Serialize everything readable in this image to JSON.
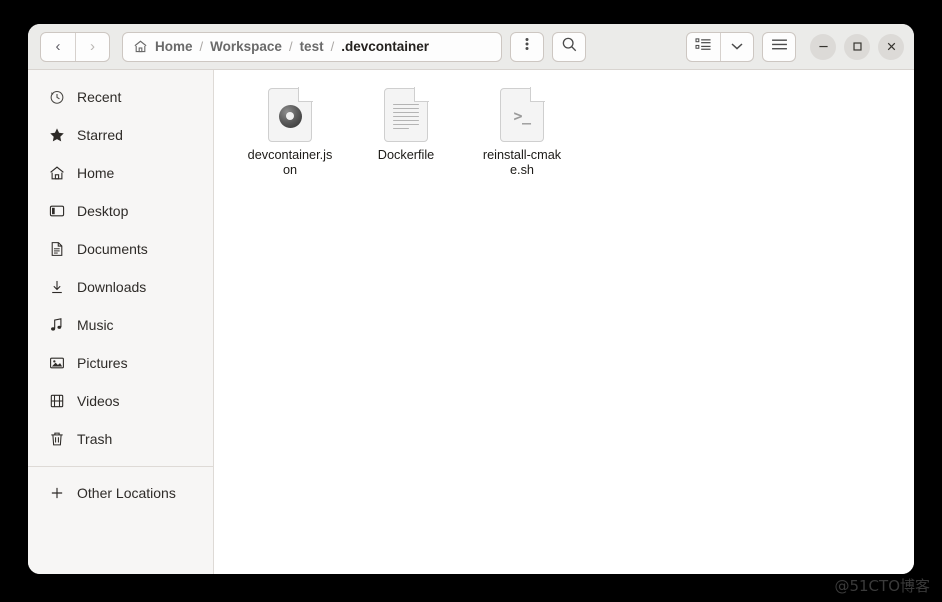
{
  "window": {
    "title": ".devcontainer",
    "background_color": "#000000",
    "headerbar_color": "#ebebe9",
    "sidebar_color": "#f7f6f5",
    "content_color": "#ffffff"
  },
  "navigation": {
    "back_icon": "chevron-left-icon",
    "forward_icon": "chevron-right-icon",
    "back_label": "‹",
    "forward_label": "›"
  },
  "pathbar": {
    "home_icon": "home-icon",
    "separator": "/",
    "crumbs": [
      {
        "label": "Home",
        "current": false
      },
      {
        "label": "Workspace",
        "current": false
      },
      {
        "label": "test",
        "current": false
      },
      {
        "label": ".devcontainer",
        "current": true
      }
    ]
  },
  "toolbar": {
    "menu_icon": "vertical-dots-icon",
    "search_icon": "search-icon",
    "list_view_icon": "list-view-icon",
    "view_dropdown_icon": "chevron-down-icon",
    "hamburger_icon": "hamburger-menu-icon"
  },
  "window_controls": {
    "minimize_label": "−",
    "maximize_label": "□",
    "close_label": "✕",
    "button_color": "#dcdad7"
  },
  "sidebar": {
    "items": [
      {
        "label": "Recent",
        "icon": "clock-icon"
      },
      {
        "label": "Starred",
        "icon": "star-icon"
      },
      {
        "label": "Home",
        "icon": "home-icon"
      },
      {
        "label": "Desktop",
        "icon": "desktop-icon"
      },
      {
        "label": "Documents",
        "icon": "document-icon"
      },
      {
        "label": "Downloads",
        "icon": "download-arrow-icon"
      },
      {
        "label": "Music",
        "icon": "music-note-icon"
      },
      {
        "label": "Pictures",
        "icon": "picture-icon"
      },
      {
        "label": "Videos",
        "icon": "film-icon"
      },
      {
        "label": "Trash",
        "icon": "trash-icon"
      }
    ],
    "other_locations": {
      "label": "Other Locations",
      "icon": "plus-icon"
    }
  },
  "files": [
    {
      "name": "devcontainer.json",
      "icon": "json-file-icon",
      "type": "json"
    },
    {
      "name": "Dockerfile",
      "icon": "text-file-icon",
      "type": "text"
    },
    {
      "name": "reinstall-cmake.sh",
      "icon": "shell-script-file-icon",
      "type": "shell"
    }
  ],
  "watermark": {
    "text": "@51CTO博客"
  }
}
